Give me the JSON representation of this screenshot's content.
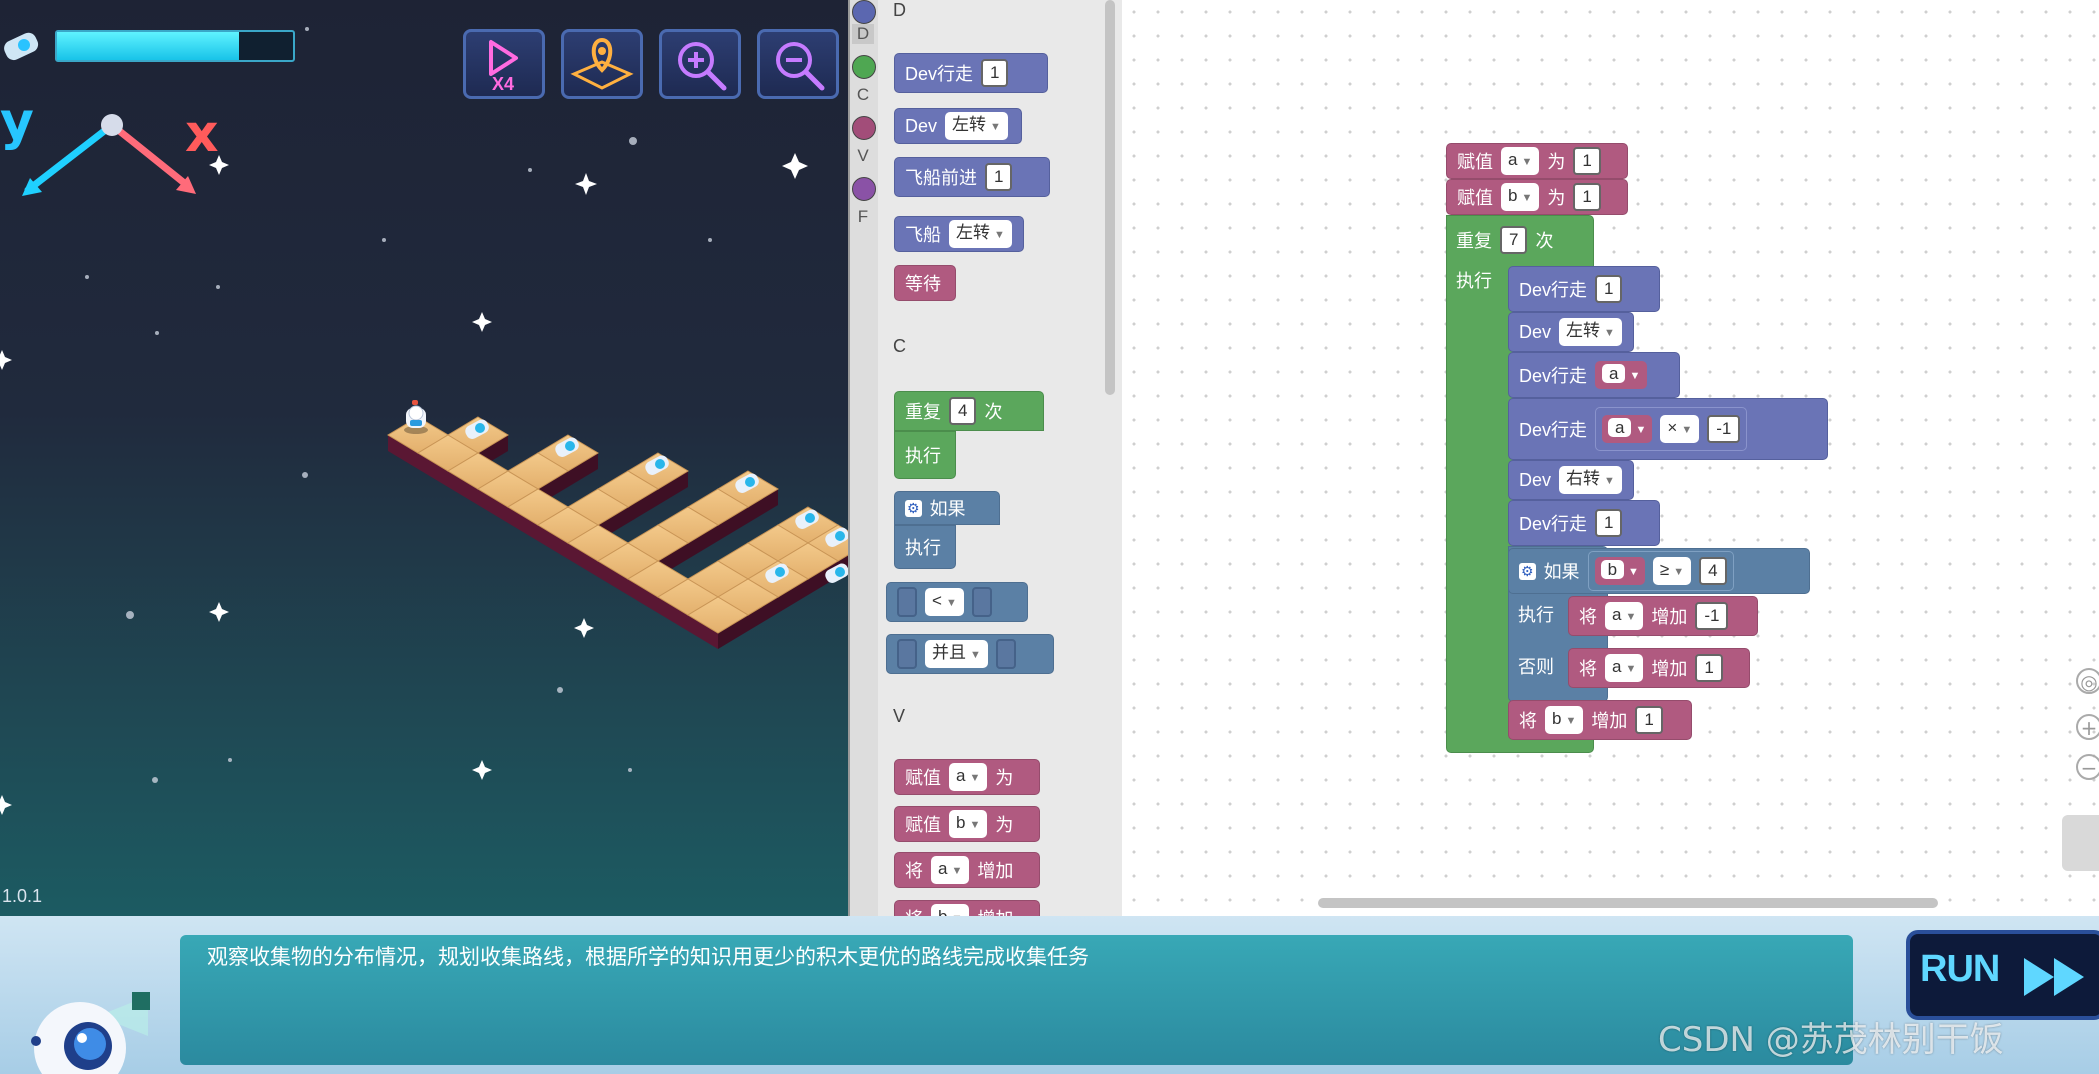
{
  "game": {
    "version": "1.0.1",
    "energy_fraction": 0.77,
    "axis_y": "y",
    "axis_x": "x",
    "tools": [
      {
        "name": "speed-x4-icon",
        "label": "X4"
      },
      {
        "name": "map-pin-icon",
        "label": ""
      },
      {
        "name": "zoom-in-icon",
        "label": ""
      },
      {
        "name": "zoom-out-icon",
        "label": ""
      }
    ]
  },
  "categories": [
    "D",
    "C",
    "V",
    "F"
  ],
  "flyout": {
    "section_d_partial": "D",
    "dev_walk": "Dev行走",
    "dev_walk_val": "1",
    "dev": "Dev",
    "turn_left": "左转",
    "ship_forward": "飞船前进",
    "ship_forward_val": "1",
    "ship": "飞船",
    "ship_turn": "左转",
    "wait": "等待",
    "section_c": "C",
    "repeat": "重复",
    "repeat_val": "4",
    "times": "次",
    "do": "执行",
    "if": "如果",
    "do2": "执行",
    "compare_op": "<",
    "and_op": "并且",
    "section_v": "V",
    "assign": "赋值",
    "var_a": "a",
    "as": "为",
    "assign2": "赋值",
    "var_b": "b",
    "as2": "为",
    "change": "将",
    "change_var": "a",
    "increase": "增加",
    "change2": "将",
    "change2_var": "b",
    "increase2": "增加"
  },
  "script": {
    "assign_label": "赋值",
    "as_label": "为",
    "a": "a",
    "b": "b",
    "a_init": "1",
    "b_init": "1",
    "repeat_label": "重复",
    "repeat_count": "7",
    "times_label": "次",
    "do_label": "执行",
    "dev_walk": "Dev行走",
    "walk1": "1",
    "dev": "Dev",
    "left": "左转",
    "walk_var": "a",
    "mul_a": "a",
    "mul_op": "×",
    "mul_val": "-1",
    "right": "右转",
    "walk2": "1",
    "if_label": "如果",
    "cond_var": "b",
    "cond_op": "≥",
    "cond_val": "4",
    "then_label": "执行",
    "set_label": "将",
    "then_var": "a",
    "inc_label": "增加",
    "then_val": "-1",
    "else_label": "否则",
    "else_var": "a",
    "else_val": "1",
    "last_var": "b",
    "last_val": "1"
  },
  "bottom": {
    "message": "观察收集物的分布情况，规划收集路线，根据所学的知识用更少的积木更优的路线完成收集任务",
    "run": "RUN",
    "watermark": "CSDN @苏茂林别干饭"
  }
}
